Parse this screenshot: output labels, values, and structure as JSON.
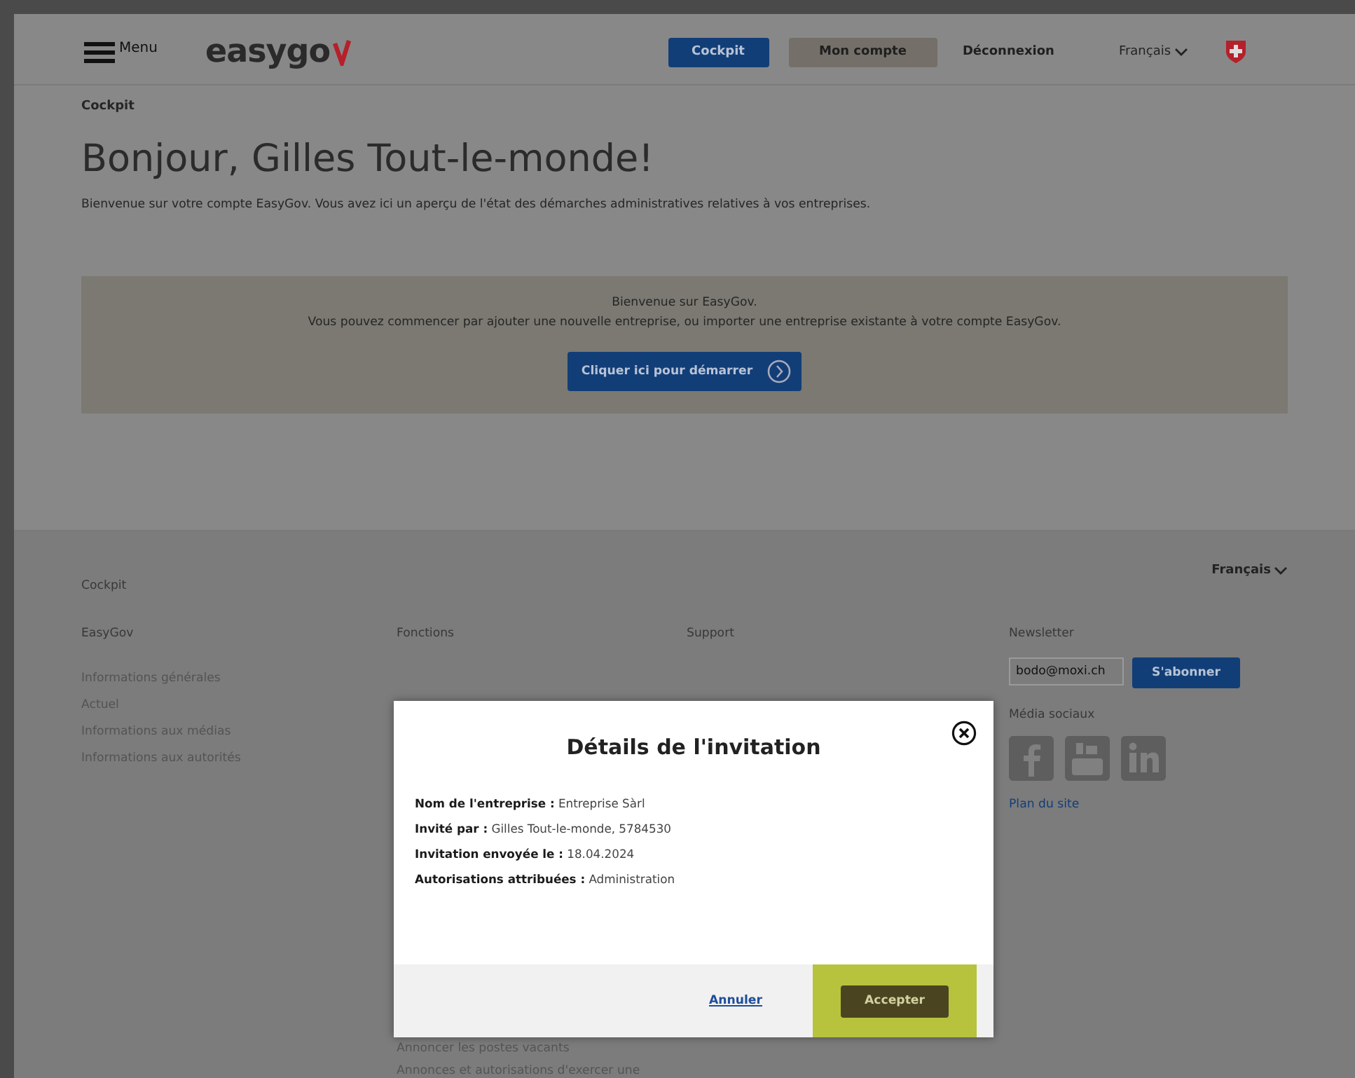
{
  "header": {
    "menu_label": "Menu",
    "logo": "easygo",
    "nav": [
      {
        "label": "Cockpit",
        "kind": "primary"
      },
      {
        "label": "Mon compte",
        "kind": "secondary"
      },
      {
        "label": "Déconnexion",
        "kind": "link"
      }
    ],
    "language": "Français"
  },
  "breadcrumb": "Cockpit",
  "title": "Bonjour, Gilles Tout-le-monde!",
  "intro": "Bienvenue sur votre compte EasyGov. Vous avez ici un aperçu de l'état des démarches administratives relatives à vos entreprises.",
  "banner": {
    "heading": "Bienvenue sur EasyGov.",
    "text": "Vous pouvez commencer par ajouter une nouvelle entreprise, ou importer une entreprise existante à votre compte EasyGov.",
    "button": "Cliquer ici pour démarrer"
  },
  "footer": {
    "breadcrumb": "Cockpit",
    "language": "Français",
    "columns": [
      {
        "heading": "EasyGov",
        "links": [
          "Informations générales",
          "Actuel",
          "Informations aux médias",
          "Informations aux autorités"
        ]
      },
      {
        "heading": "Fonctions",
        "links": [
          "Annoncer les postes vacants",
          "Annonces et autorisations d'exercer une"
        ]
      },
      {
        "heading": "Support"
      }
    ],
    "newsletter": {
      "heading": "Newsletter",
      "value": "bodo@moxi.ch",
      "button": "S'abonner"
    },
    "social": {
      "heading": "Média sociaux"
    },
    "sitemap": "Plan du site"
  },
  "dialog": {
    "title": "Détails de l'invitation",
    "fields": [
      {
        "label": "Nom de l'entreprise :",
        "value": "Entreprise Sàrl"
      },
      {
        "label": "Invité par :",
        "value": "Gilles Tout-le-monde, 5784530"
      },
      {
        "label": "Invitation envoyée le :",
        "value": "18.04.2024"
      },
      {
        "label": "Autorisations attribuées :",
        "value": "Administration"
      }
    ],
    "buttons": [
      {
        "label": "Annuler",
        "kind": "link",
        "highlighted": false
      },
      {
        "label": "Accepter",
        "kind": "primary",
        "highlighted": true
      }
    ]
  }
}
